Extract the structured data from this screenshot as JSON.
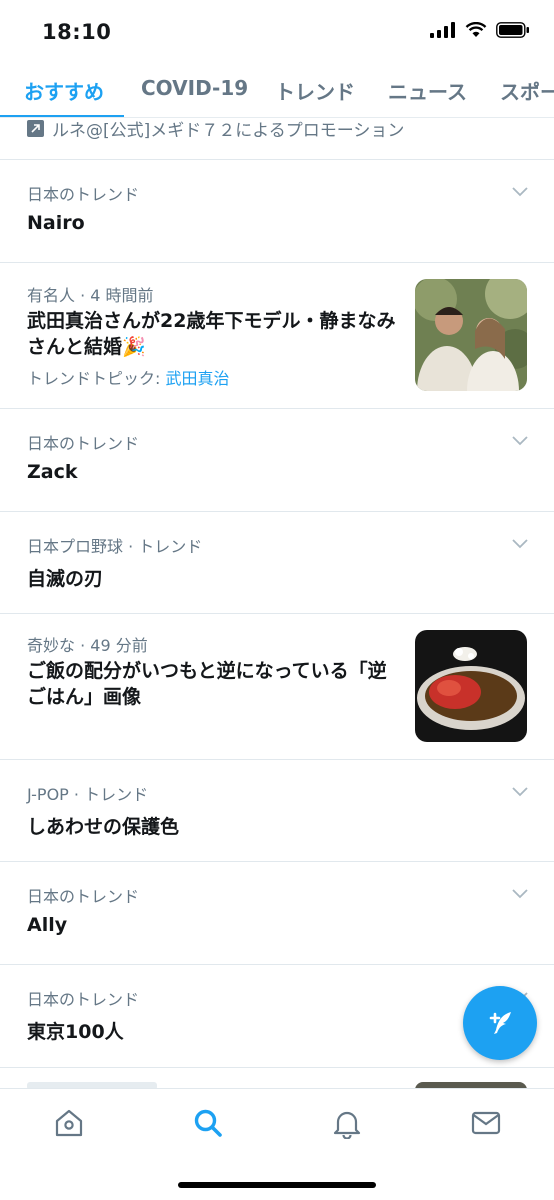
{
  "status": {
    "time": "18:10"
  },
  "tabs": [
    {
      "label": "おすすめ"
    },
    {
      "label": "COVID-19"
    },
    {
      "label": "トレンド"
    },
    {
      "label": "ニュース"
    },
    {
      "label": "スポー"
    }
  ],
  "promo": {
    "text": "ルネ@[公式]メギド７２によるプロモーション"
  },
  "trends": [
    {
      "meta": "日本のトレンド",
      "title": "Nairo"
    },
    {
      "meta": "有名人 · 4 時間前",
      "title": "武田真治さんが22歳年下モデル・静まなみさんと結婚🎉",
      "sub_prefix": "トレンドトピック: ",
      "sub_link": "武田真治"
    },
    {
      "meta": "日本のトレンド",
      "title": "Zack"
    },
    {
      "meta": "日本プロ野球 · トレンド",
      "title": "自滅の刃"
    },
    {
      "meta": "奇妙な · 49 分前",
      "title": "ご飯の配分がいつもと逆になっている「逆ごはん」画像"
    },
    {
      "meta": "J-POP · トレンド",
      "title": "しあわせの保護色"
    },
    {
      "meta": "日本のトレンド",
      "title": "Ally"
    },
    {
      "meta": "日本のトレンド",
      "title": "東京100人"
    }
  ],
  "icons": {
    "promo": "promoted-icon",
    "chevron": "chevron-down-icon",
    "compose": "compose-tweet-icon",
    "nav": [
      "home-icon",
      "search-icon",
      "notifications-bell-icon",
      "messages-envelope-icon"
    ]
  },
  "colors": {
    "accent": "#1da1f2",
    "muted": "#657786",
    "text": "#14171a"
  }
}
